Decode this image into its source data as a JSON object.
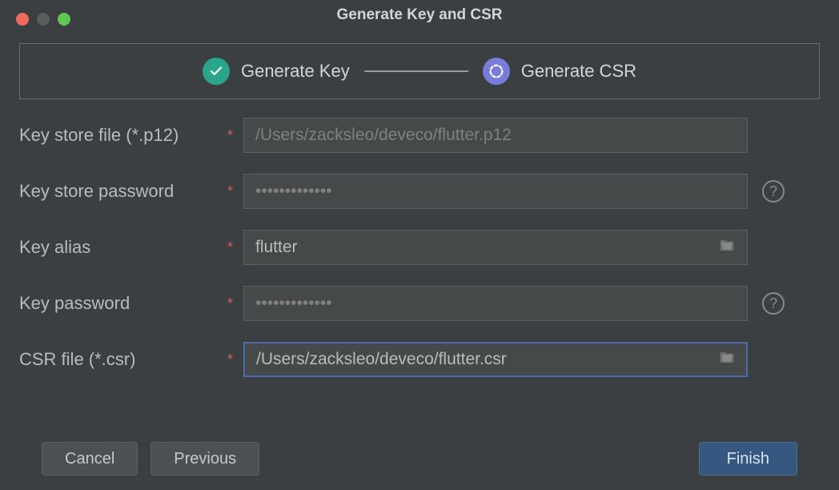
{
  "window": {
    "title": "Generate Key and CSR"
  },
  "stepper": {
    "step1": {
      "label": "Generate Key"
    },
    "step2": {
      "label": "Generate CSR"
    }
  },
  "form": {
    "keystore_file": {
      "label": "Key store file (*.p12)",
      "value": "/Users/zacksleo/deveco/flutter.p12"
    },
    "keystore_password": {
      "label": "Key store password",
      "value": "•••••••••••••"
    },
    "key_alias": {
      "label": "Key alias",
      "value": "flutter"
    },
    "key_password": {
      "label": "Key password",
      "value": "•••••••••••••"
    },
    "csr_file": {
      "label": "CSR file (*.csr)",
      "value": "/Users/zacksleo/deveco/flutter.csr"
    }
  },
  "buttons": {
    "cancel": "Cancel",
    "previous": "Previous",
    "finish": "Finish"
  }
}
